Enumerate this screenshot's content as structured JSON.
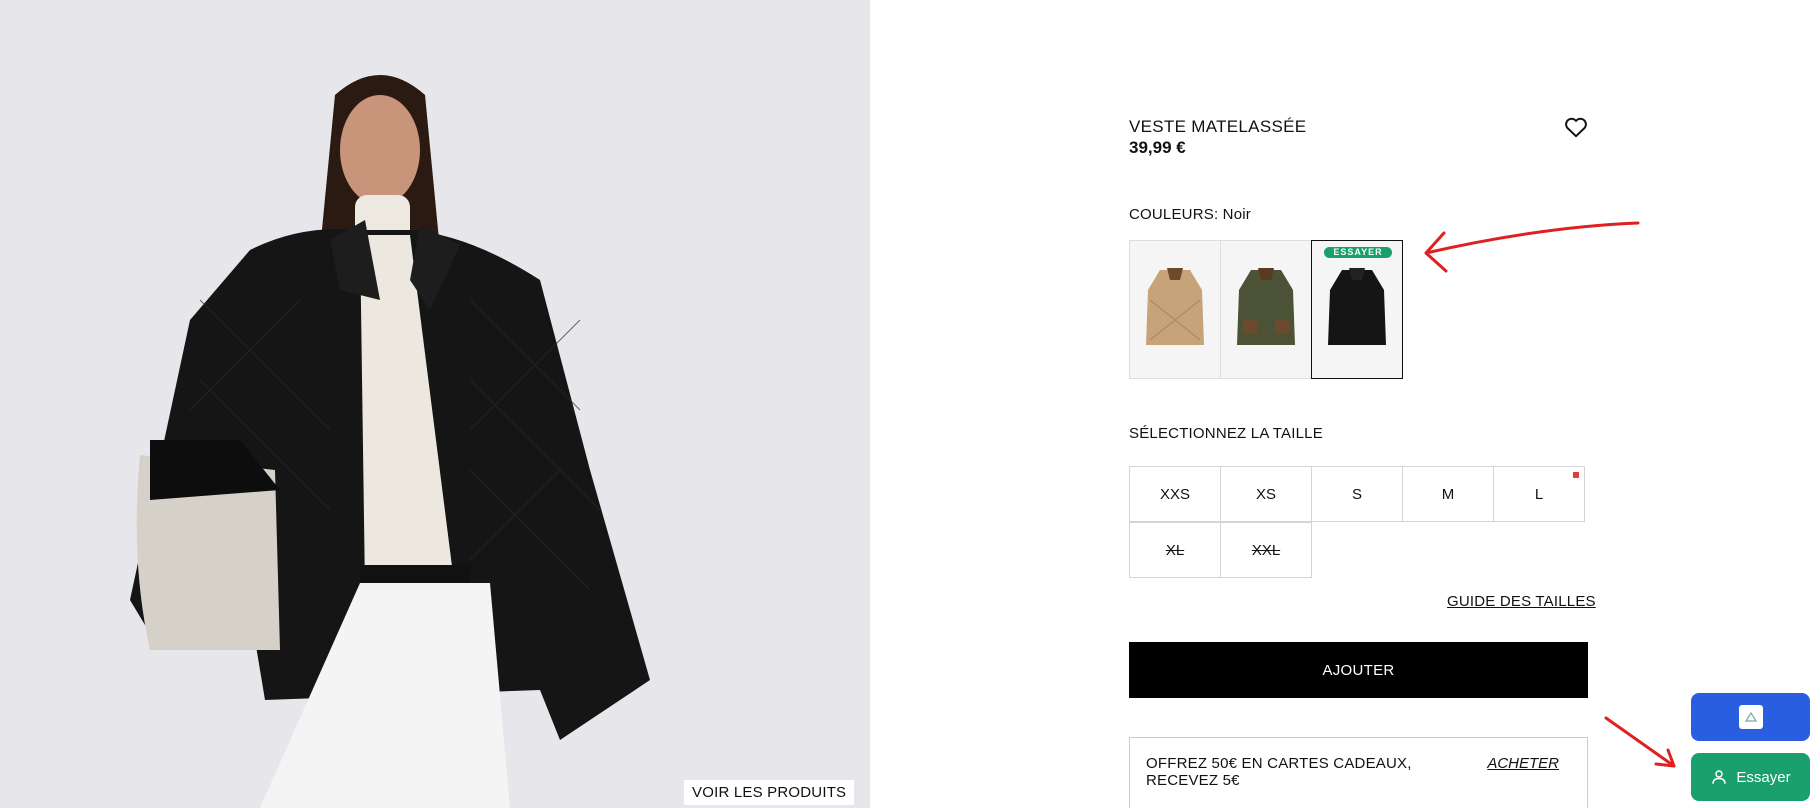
{
  "hero": {
    "cta_label": "VOIR LES PRODUITS"
  },
  "product": {
    "title": "VESTE MATELASSÉE",
    "price": "39,99 €",
    "colors_label": "COULEURS: Noir",
    "swatches": [
      {
        "name": "beige",
        "color": "#c7a37a"
      },
      {
        "name": "kaki",
        "color": "#4b5236"
      },
      {
        "name": "noir",
        "color": "#151515",
        "badge": "ESSAYER",
        "selected": true
      }
    ],
    "size_label": "SÉLECTIONNEZ LA TAILLE",
    "sizes": [
      "XXS",
      "XS",
      "S",
      "M",
      "L",
      "XL",
      "XXL"
    ],
    "sizes_unavailable": [
      "XL",
      "XXL"
    ],
    "size_guide_label": "GUIDE DES TAILLES",
    "add_label": "AJOUTER",
    "promo_text": "OFFREZ 50€ EN CARTES CADEAUX, RECEVEZ 5€",
    "promo_link": "ACHETER"
  },
  "widgets": {
    "try_label": "Essayer",
    "try_color": "#1aa06c",
    "top_color": "#2a5ee0"
  },
  "icons": [
    "heart-icon",
    "user-icon",
    "app-logo-icon"
  ]
}
